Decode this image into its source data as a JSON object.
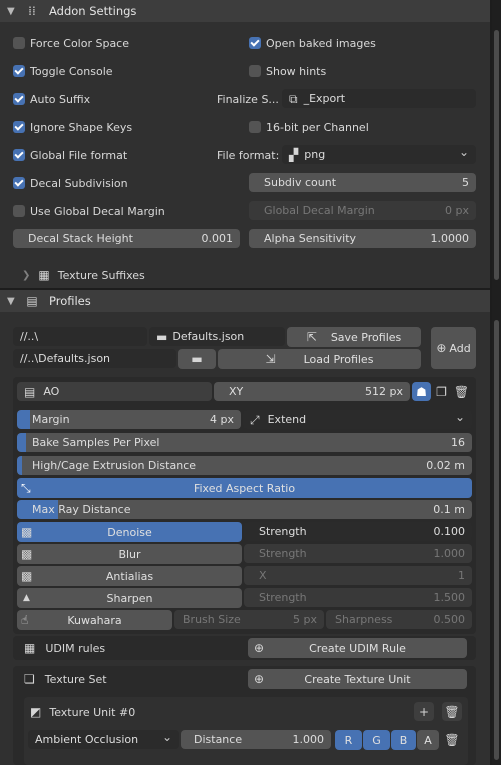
{
  "addon": {
    "title": "Addon Settings",
    "checks_left": [
      {
        "label": "Force Color Space",
        "on": false
      },
      {
        "label": "Toggle Console",
        "on": true
      },
      {
        "label": "Auto Suffix",
        "on": true
      },
      {
        "label": "Ignore Shape Keys",
        "on": true
      },
      {
        "label": "Global File format",
        "on": true
      },
      {
        "label": "Decal Subdivision",
        "on": true
      },
      {
        "label": "Use Global Decal Margin",
        "on": false
      }
    ],
    "open_baked": "Open baked images",
    "show_hints": "Show hints",
    "finalize_label": "Finalize S...",
    "finalize_value": "_Export",
    "bit16": "16-bit per Channel",
    "file_format_label": "File format:",
    "file_format_value": "png",
    "subdiv_label": "Subdiv count",
    "subdiv_value": "5",
    "global_margin_label": "Global Decal Margin",
    "global_margin_value": "0 px",
    "stack_label": "Decal Stack Height",
    "stack_value": "0.001",
    "alpha_label": "Alpha Sensitivity",
    "alpha_value": "1.0000",
    "suffixes": "Texture Suffixes"
  },
  "profiles": {
    "title": "Profiles",
    "path1": "//..\\",
    "file1": "Defaults.json",
    "save": "Save Profiles",
    "path2": "//..\\Defaults.json",
    "load": "Load Profiles",
    "add": "Add",
    "map_name": "AO",
    "res_label": "XY",
    "res_value": "512 px",
    "margin_label": "Margin",
    "margin_value": "4 px",
    "extend": "Extend",
    "samples_label": "Bake Samples Per Pixel",
    "samples_value": "16",
    "cage_label": "High/Cage Extrusion Distance",
    "cage_value": "0.02 m",
    "fixed": "Fixed Aspect Ratio",
    "ray_label": "Max Ray Distance",
    "ray_value": "0.1 m",
    "filters": [
      {
        "name": "Denoise",
        "p": "Strength",
        "v": "0.100",
        "active": true
      },
      {
        "name": "Blur",
        "p": "Strength",
        "v": "1.000",
        "active": false
      },
      {
        "name": "Antialias",
        "p": "X",
        "v": "1",
        "active": false
      },
      {
        "name": "Sharpen",
        "p": "Strength",
        "v": "1.500",
        "active": false
      }
    ],
    "kuwahara": "Kuwahara",
    "brush_label": "Brush Size",
    "brush_value": "5 px",
    "sharp_label": "Sharpness",
    "sharp_value": "0.500",
    "udim": "UDIM rules",
    "create_udim": "Create UDIM Rule",
    "texset": "Texture Set",
    "create_unit": "Create Texture Unit",
    "unit_title": "Texture Unit #0",
    "unit_type": "Ambient Occlusion",
    "dist_label": "Distance",
    "dist_value": "1.000",
    "channels": [
      "R",
      "G",
      "B",
      "A"
    ]
  }
}
